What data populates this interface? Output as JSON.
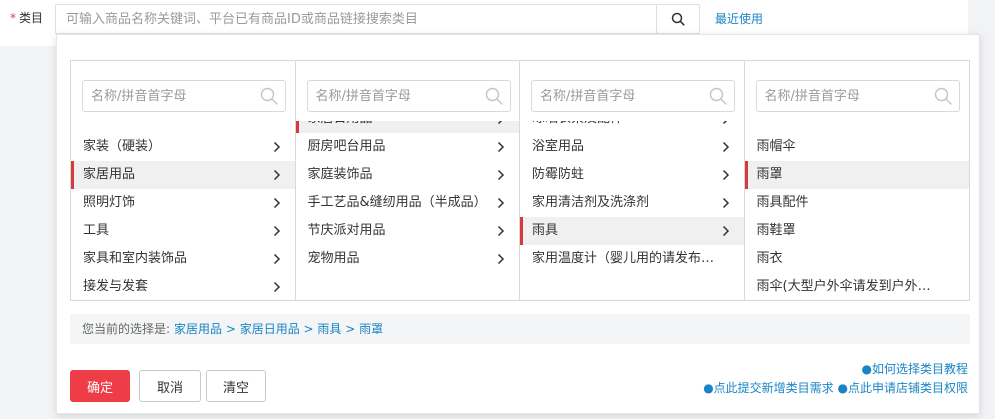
{
  "field": {
    "required_mark": "*",
    "label": "类目",
    "search_placeholder": "可输入商品名称关键词、平台已有商品ID或商品链接搜索类目",
    "search_icon": "search-icon",
    "recent_link": "最近使用"
  },
  "columns": [
    {
      "placeholder": "名称/拼音首字母",
      "items": [
        {
          "label": "家装（硬装）",
          "has_children": true
        },
        {
          "label": "家居用品",
          "has_children": true,
          "active": true
        },
        {
          "label": "照明灯饰",
          "has_children": true
        },
        {
          "label": "工具",
          "has_children": true
        },
        {
          "label": "家具和室内装饰品",
          "has_children": true
        },
        {
          "label": "接发与发套",
          "has_children": true
        }
      ]
    },
    {
      "placeholder": "名称/拼音首字母",
      "items": [
        {
          "label": "家居日用品",
          "has_children": true,
          "active": true,
          "clipped": true
        },
        {
          "label": "厨房吧台用品",
          "has_children": true
        },
        {
          "label": "家庭装饰品",
          "has_children": true
        },
        {
          "label": "手工艺品&缝纫用品（半成品）",
          "has_children": true
        },
        {
          "label": "节庆派对用品",
          "has_children": true
        },
        {
          "label": "宠物用品",
          "has_children": true
        }
      ]
    },
    {
      "placeholder": "名称/拼音首字母",
      "items": [
        {
          "label": "晾晒衣架及配件",
          "has_children": true,
          "clipped": true
        },
        {
          "label": "浴室用品",
          "has_children": true
        },
        {
          "label": "防霉防蛀",
          "has_children": true
        },
        {
          "label": "家用清洁剂及洗涤剂",
          "has_children": true
        },
        {
          "label": "雨具",
          "has_children": true,
          "active": true
        },
        {
          "label": "家用温度计（婴儿用的请发布…",
          "has_children": false
        }
      ]
    },
    {
      "placeholder": "名称/拼音首字母",
      "items": [
        {
          "label": "雨帽伞",
          "has_children": false
        },
        {
          "label": "雨罩",
          "has_children": false,
          "active": true
        },
        {
          "label": "雨具配件",
          "has_children": false
        },
        {
          "label": "雨鞋罩",
          "has_children": false
        },
        {
          "label": "雨衣",
          "has_children": false
        },
        {
          "label": "雨伞(大型户外伞请发到户外…",
          "has_children": false
        }
      ]
    }
  ],
  "selection": {
    "label": "您当前的选择是:",
    "path": "家居用品 > 家居日用品 > 雨具 > 雨罩"
  },
  "buttons": {
    "ok": "确定",
    "cancel": "取消",
    "clear": "清空"
  },
  "help": {
    "tutorial": "●如何选择类目教程",
    "submit_request": "●点此提交新增类目需求",
    "apply_permission": "●点此申请店铺类目权限"
  },
  "colors": {
    "accent_red": "#ee3d46",
    "link_blue": "#1a84c6"
  }
}
